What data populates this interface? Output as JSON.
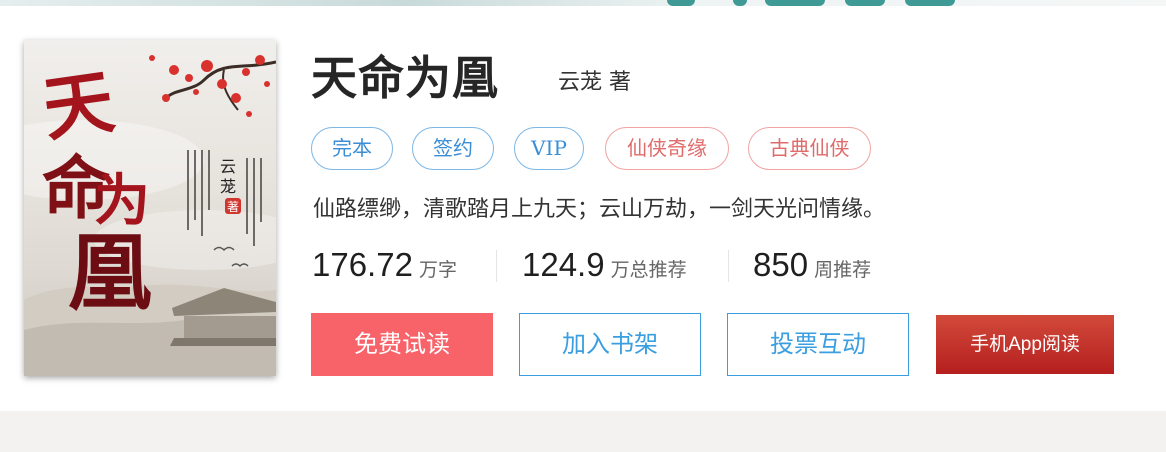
{
  "book": {
    "title": "天命为凰",
    "author": "云茏  著",
    "intro": "仙路缥缈，清歌踏月上九天；云山万劫，一剑天光问情缘。",
    "cover": {
      "title_art": "天命为凰",
      "author_mark": "云茏",
      "seal": "著"
    }
  },
  "tags": [
    {
      "label": "完本",
      "style": "blue"
    },
    {
      "label": "签约",
      "style": "blue"
    },
    {
      "label": "VIP",
      "style": "blue"
    },
    {
      "label": "仙侠奇缘",
      "style": "red"
    },
    {
      "label": "古典仙侠",
      "style": "red"
    }
  ],
  "stats": [
    {
      "value": "176.72",
      "unit": "万字"
    },
    {
      "value": "124.9",
      "unit": "万总推荐"
    },
    {
      "value": "850",
      "unit": "周推荐"
    }
  ],
  "actions": {
    "free_read": "免费试读",
    "add_shelf": "加入书架",
    "vote": "投票互动",
    "app_read": "手机App阅读"
  },
  "colors": {
    "primary_red": "#f8636a",
    "link_blue": "#3a9ee0",
    "tag_red": "#e06b6b",
    "app_red": "#b51f1f"
  }
}
